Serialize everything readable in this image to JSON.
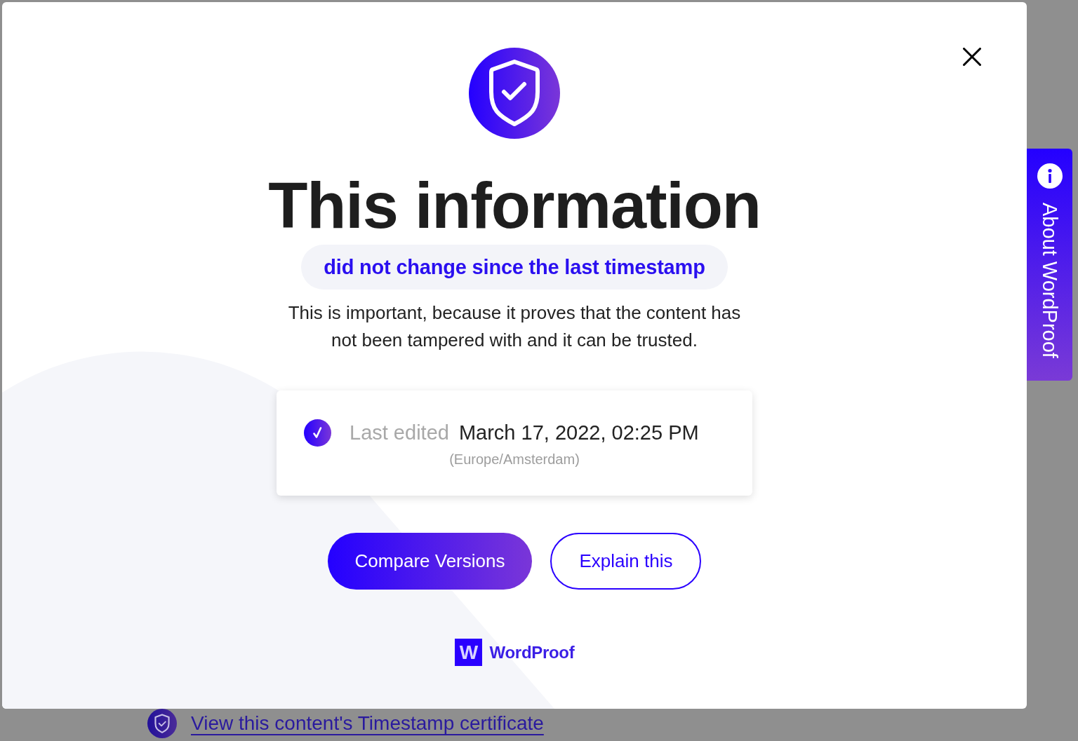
{
  "backdrop": {
    "link": "View this content's Timestamp certificate"
  },
  "side_tab": {
    "label": "About WordProof"
  },
  "modal": {
    "title": "This information",
    "status": "did not change since the last timestamp",
    "description": "This is important, because it proves that the content has not been tampered with and it can be trusted.",
    "card": {
      "label": "Last edited",
      "date": "March 17, 2022, 02:25 PM",
      "timezone": "(Europe/Amsterdam)"
    },
    "buttons": [
      {
        "label": "Compare Versions",
        "kind": "primary"
      },
      {
        "label": "Explain this",
        "kind": "secondary"
      }
    ],
    "logo": {
      "mark": "W",
      "name": "WordProof"
    }
  }
}
